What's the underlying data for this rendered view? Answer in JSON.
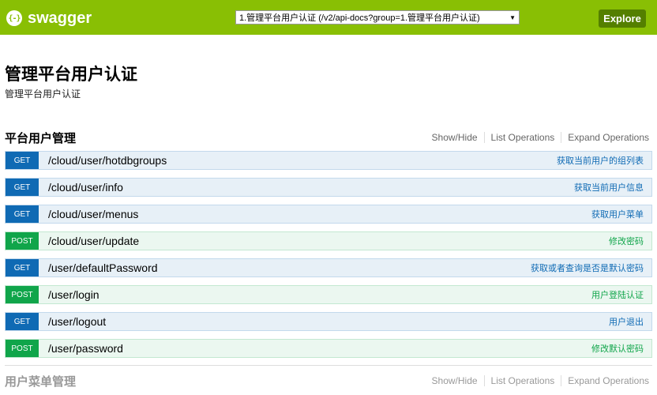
{
  "header": {
    "logo_icon": "{-}",
    "logo_text": "swagger",
    "spec_selected": "1.管理平台用户认证 (/v2/api-docs?group=1.管理平台用户认证)",
    "explore_label": "Explore",
    "colors": {
      "bar": "#89bf04",
      "explore": "#547f00"
    }
  },
  "info": {
    "title": "管理平台用户认证",
    "description": "管理平台用户认证"
  },
  "groups": [
    {
      "title": "平台用户管理",
      "show_hide": "Show/Hide",
      "list_ops": "List Operations",
      "expand_ops": "Expand Operations",
      "operations": [
        {
          "method": "GET",
          "path": "/cloud/user/hotdbgroups",
          "summary": "获取当前用户的组列表"
        },
        {
          "method": "GET",
          "path": "/cloud/user/info",
          "summary": "获取当前用户信息"
        },
        {
          "method": "GET",
          "path": "/cloud/user/menus",
          "summary": "获取用户菜单"
        },
        {
          "method": "POST",
          "path": "/cloud/user/update",
          "summary": "修改密码"
        },
        {
          "method": "GET",
          "path": "/user/defaultPassword",
          "summary": "获取或者查询是否是默认密码"
        },
        {
          "method": "POST",
          "path": "/user/login",
          "summary": "用户登陆认证"
        },
        {
          "method": "GET",
          "path": "/user/logout",
          "summary": "用户退出"
        },
        {
          "method": "POST",
          "path": "/user/password",
          "summary": "修改默认密码"
        }
      ]
    },
    {
      "title": "用户菜单管理",
      "show_hide": "Show/Hide",
      "list_ops": "List Operations",
      "expand_ops": "Expand Operations"
    }
  ],
  "method_colors": {
    "GET": "#0f6ab4",
    "POST": "#10a54a"
  }
}
